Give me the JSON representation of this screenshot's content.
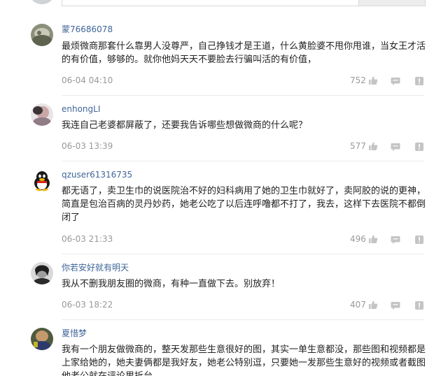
{
  "comments": [
    {
      "username": "蒙76686078",
      "text": "最烦微商那套什么靠男人没尊严，自己挣钱才是王道，什么黄脸婆不甩你甩谁，当女王才活的有价值，够够的。就你他妈天天不要脸去行骗叫活的有价值，",
      "time": "06-04 04:10",
      "likes": "752"
    },
    {
      "username": "enhongLI",
      "text": "我连自己老婆都屏蔽了，还要我告诉哪些想做微商的什么呢？",
      "time": "06-03 13:39",
      "likes": "577"
    },
    {
      "username": "qzuser61316735",
      "text": "都无语了，卖卫生巾的说医院治不好的妇科病用了她的卫生巾就好了，卖阿胶的说的更神，简直是包治百病的灵丹妙药，她老公吃了以后连呼噜都不打了，我去，这样下去医院不都倒闭了",
      "time": "06-03 21:33",
      "likes": "496"
    },
    {
      "username": "你若安好就有明天",
      "text": "我从不删我朋友圈的微商，有种一直做下去。别放弃！",
      "time": "06-03 18:22",
      "likes": "407"
    },
    {
      "username": "夏惜梦",
      "text": "我有一个朋友做微商的，整天发那些生意很好的图，其实一单生意都没，那些图和视频都是上家给她的，她夫妻俩都是我好友，她老公特别逗，只要她一发那些生意好的视频或者截图他老公就在评论里拆台",
      "time": "",
      "likes": ""
    }
  ],
  "icons": {
    "like": "thumbs-up-icon",
    "reply": "speech-bubble-icon",
    "report": "exclamation-icon"
  },
  "colors": {
    "username": "#406599",
    "text": "#222222",
    "meta": "#999999",
    "icon": "#c4c4c4"
  }
}
